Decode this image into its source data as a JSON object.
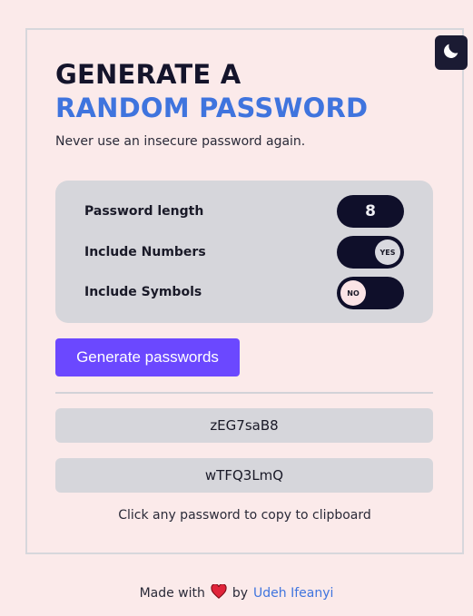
{
  "header": {
    "title_line1": "GENERATE A",
    "title_line2": "RANDOM PASSWORD",
    "subtitle": "Never use an insecure password again."
  },
  "theme_toggle": {
    "icon": "moon-icon"
  },
  "options": {
    "length": {
      "label": "Password length",
      "value": "8"
    },
    "numbers": {
      "label": "Include Numbers",
      "state": "YES"
    },
    "symbols": {
      "label": "Include Symbols",
      "state": "NO"
    }
  },
  "generate_button": {
    "label": "Generate passwords"
  },
  "passwords": [
    "zEG7saB8",
    "wTFQ3LmQ"
  ],
  "hint": "Click any password to copy to clipboard",
  "footer": {
    "made_with": "Made with",
    "by": "by",
    "author": "Udeh Ifeanyi",
    "heart_icon": "heart-icon"
  },
  "colors": {
    "accent": "#3f74de",
    "button": "#6b48ff",
    "dark": "#0f0f2a",
    "background": "#fbeaea"
  }
}
